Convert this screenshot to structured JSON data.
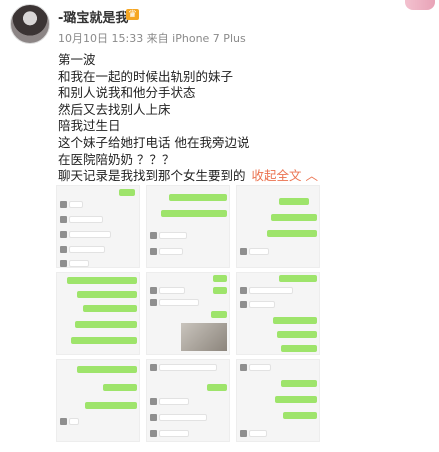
{
  "post": {
    "username": "-璐宝就是我-",
    "timestamp": "10月10日 15:33 来自 iPhone 7 Plus",
    "lines": [
      "第一波",
      "和我在一起的时候出轨别的妹子",
      "和别人说我和他分手状态",
      "然后又去找别人上床",
      "陪我过生日",
      "这个妹子给她打电话 他在我旁边说",
      "在医院陪奶奶 ？？？"
    ],
    "last_line": "聊天记录是我找到那个女生要到的",
    "expand_label": "收起全文 ︿"
  },
  "colors": {
    "link": "#eb7350",
    "chat_green": "#9ee46b",
    "badge": "#f5a623"
  },
  "icons": {
    "avatar": "user-avatar",
    "badge": "crown-icon"
  },
  "images": {
    "count": 9,
    "layout": "3x3 grid of chat screenshots"
  }
}
